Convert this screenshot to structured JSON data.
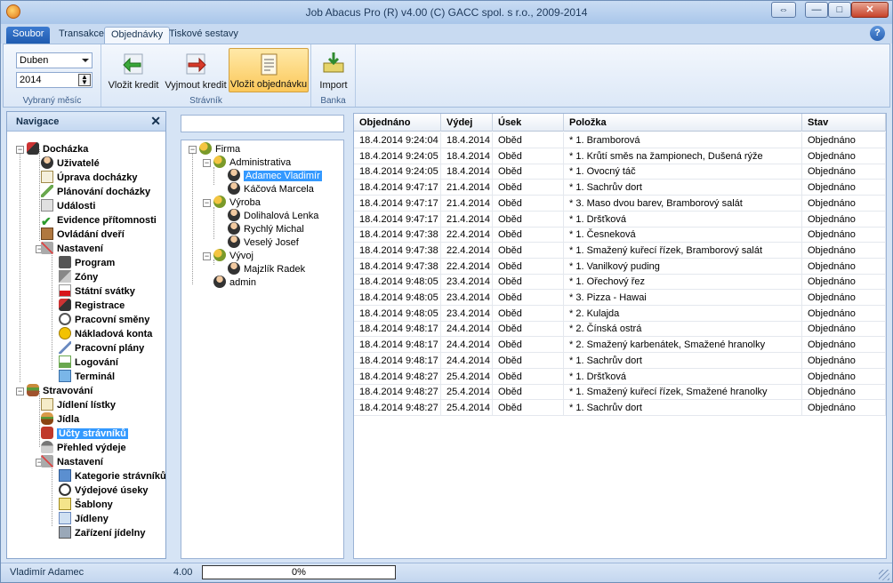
{
  "window": {
    "title": "Job Abacus Pro (R) v4.00 (C) GACC spol. s r.o., 2009-2014",
    "controls": [
      "⇔",
      "—",
      "□",
      "✕"
    ]
  },
  "ribbon_tabs": [
    "Soubor",
    "Transakce",
    "Objednávky",
    "Tiskové sestavy"
  ],
  "help_label": "?",
  "ribbon": {
    "month_value": "Duben",
    "year_value": "2014",
    "month_group_label": "Vybraný měsíc",
    "stravnik_group_label": "Strávník",
    "banka_group_label": "Banka",
    "buttons": {
      "vlozit_kredit": "Vložit kredit",
      "vyjmout_kredit": "Vyjmout kredit",
      "vlozit_objednavku": "Vložit objednávku",
      "import": "Import"
    }
  },
  "navigation": {
    "title": "Navigace",
    "close": "✕",
    "items": [
      {
        "label": "Docházka"
      },
      {
        "label": "Uživatelé"
      },
      {
        "label": "Úprava docházky"
      },
      {
        "label": "Plánování docházky"
      },
      {
        "label": "Události"
      },
      {
        "label": "Evidence přítomnosti"
      },
      {
        "label": "Ovládání dveří"
      },
      {
        "label": "Nastavení"
      },
      {
        "label": "Program"
      },
      {
        "label": "Zóny"
      },
      {
        "label": "Státní svátky"
      },
      {
        "label": "Registrace"
      },
      {
        "label": "Pracovní směny"
      },
      {
        "label": "Nákladová konta"
      },
      {
        "label": "Pracovní plány"
      },
      {
        "label": "Logování"
      },
      {
        "label": "Terminál"
      },
      {
        "label": "Stravování"
      },
      {
        "label": "Jídlení lístky"
      },
      {
        "label": "Jídla"
      },
      {
        "label": "Účty strávníků"
      },
      {
        "label": "Přehled výdeje"
      },
      {
        "label": "Nastavení"
      },
      {
        "label": "Kategorie strávníků"
      },
      {
        "label": "Výdejové úseky"
      },
      {
        "label": "Šablony"
      },
      {
        "label": "Jídleny"
      },
      {
        "label": "Zařízení jídelny"
      }
    ]
  },
  "org_tree": {
    "search_value": "",
    "items": [
      {
        "label": "Firma"
      },
      {
        "label": "Administrativa"
      },
      {
        "label": "Adamec Vladimír"
      },
      {
        "label": "Káčová Marcela"
      },
      {
        "label": "Výroba"
      },
      {
        "label": "Dolihalová Lenka"
      },
      {
        "label": "Rychlý Michal"
      },
      {
        "label": "Veselý Josef"
      },
      {
        "label": "Vývoj"
      },
      {
        "label": "Majzlík Radek"
      },
      {
        "label": "admin"
      }
    ]
  },
  "grid": {
    "columns": [
      "Objednáno",
      "Výdej",
      "Úsek",
      "Položka",
      "Stav"
    ],
    "rows": [
      [
        "18.4.2014 9:24:04",
        "18.4.2014",
        "Oběd",
        "* 1. Bramborová",
        "Objednáno"
      ],
      [
        "18.4.2014 9:24:05",
        "18.4.2014",
        "Oběd",
        "* 1. Krůtí směs na žampionech, Dušená rýže",
        "Objednáno"
      ],
      [
        "18.4.2014 9:24:05",
        "18.4.2014",
        "Oběd",
        "* 1. Ovocný táč",
        "Objednáno"
      ],
      [
        "18.4.2014 9:47:17",
        "21.4.2014",
        "Oběd",
        "* 1. Sachrův dort",
        "Objednáno"
      ],
      [
        "18.4.2014 9:47:17",
        "21.4.2014",
        "Oběd",
        "* 3. Maso dvou barev, Bramborový salát",
        "Objednáno"
      ],
      [
        "18.4.2014 9:47:17",
        "21.4.2014",
        "Oběd",
        "* 1. Dršťková",
        "Objednáno"
      ],
      [
        "18.4.2014 9:47:38",
        "22.4.2014",
        "Oběd",
        "* 1. Česneková",
        "Objednáno"
      ],
      [
        "18.4.2014 9:47:38",
        "22.4.2014",
        "Oběd",
        "* 1. Smažený kuřecí řízek, Bramborový salát",
        "Objednáno"
      ],
      [
        "18.4.2014 9:47:38",
        "22.4.2014",
        "Oběd",
        "* 1. Vanilkový puding",
        "Objednáno"
      ],
      [
        "18.4.2014 9:48:05",
        "23.4.2014",
        "Oběd",
        "* 1. Ořechový řez",
        "Objednáno"
      ],
      [
        "18.4.2014 9:48:05",
        "23.4.2014",
        "Oběd",
        "* 3. Pizza - Hawai",
        "Objednáno"
      ],
      [
        "18.4.2014 9:48:05",
        "23.4.2014",
        "Oběd",
        "* 2. Kulajda",
        "Objednáno"
      ],
      [
        "18.4.2014 9:48:17",
        "24.4.2014",
        "Oběd",
        "* 2. Čínská ostrá",
        "Objednáno"
      ],
      [
        "18.4.2014 9:48:17",
        "24.4.2014",
        "Oběd",
        "* 2. Smažený karbenátek, Smažené hranolky",
        "Objednáno"
      ],
      [
        "18.4.2014 9:48:17",
        "24.4.2014",
        "Oběd",
        "* 1. Sachrův dort",
        "Objednáno"
      ],
      [
        "18.4.2014 9:48:27",
        "25.4.2014",
        "Oběd",
        "* 1. Dršťková",
        "Objednáno"
      ],
      [
        "18.4.2014 9:48:27",
        "25.4.2014",
        "Oběd",
        "* 1. Smažený kuřecí řízek, Smažené hranolky",
        "Objednáno"
      ],
      [
        "18.4.2014 9:48:27",
        "25.4.2014",
        "Oběd",
        "* 1. Sachrův dort",
        "Objednáno"
      ]
    ]
  },
  "status": {
    "user": "Vladimír Adamec",
    "version": "4.00",
    "progress_label": "0%",
    "progress": 0
  }
}
